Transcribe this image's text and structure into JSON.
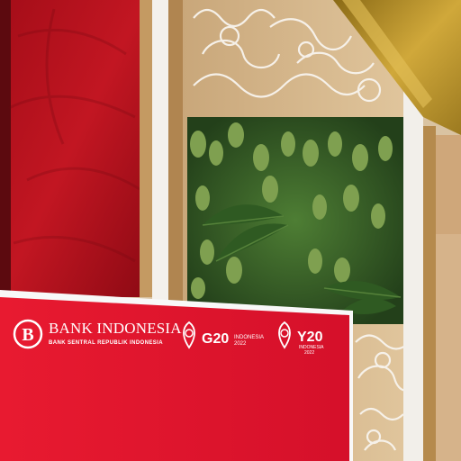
{
  "banner": {
    "bank_name": "BANK INDONESIA",
    "bank_subtitle": "BANK SENTRAL REPUBLIK INDONESIA",
    "g20_label": "G20",
    "g20_country": "INDONESIA",
    "g20_year": "2022",
    "y20_label": "Y20",
    "y20_country": "INDONESIA",
    "y20_year": "2022"
  },
  "colors": {
    "red_wall": "#b3101a",
    "banner_red": "#e3142c",
    "wood": "#d4b48a",
    "foliage": "#3f6b2b",
    "gold": "#b8902a",
    "white_frame": "#f7f5f2"
  }
}
